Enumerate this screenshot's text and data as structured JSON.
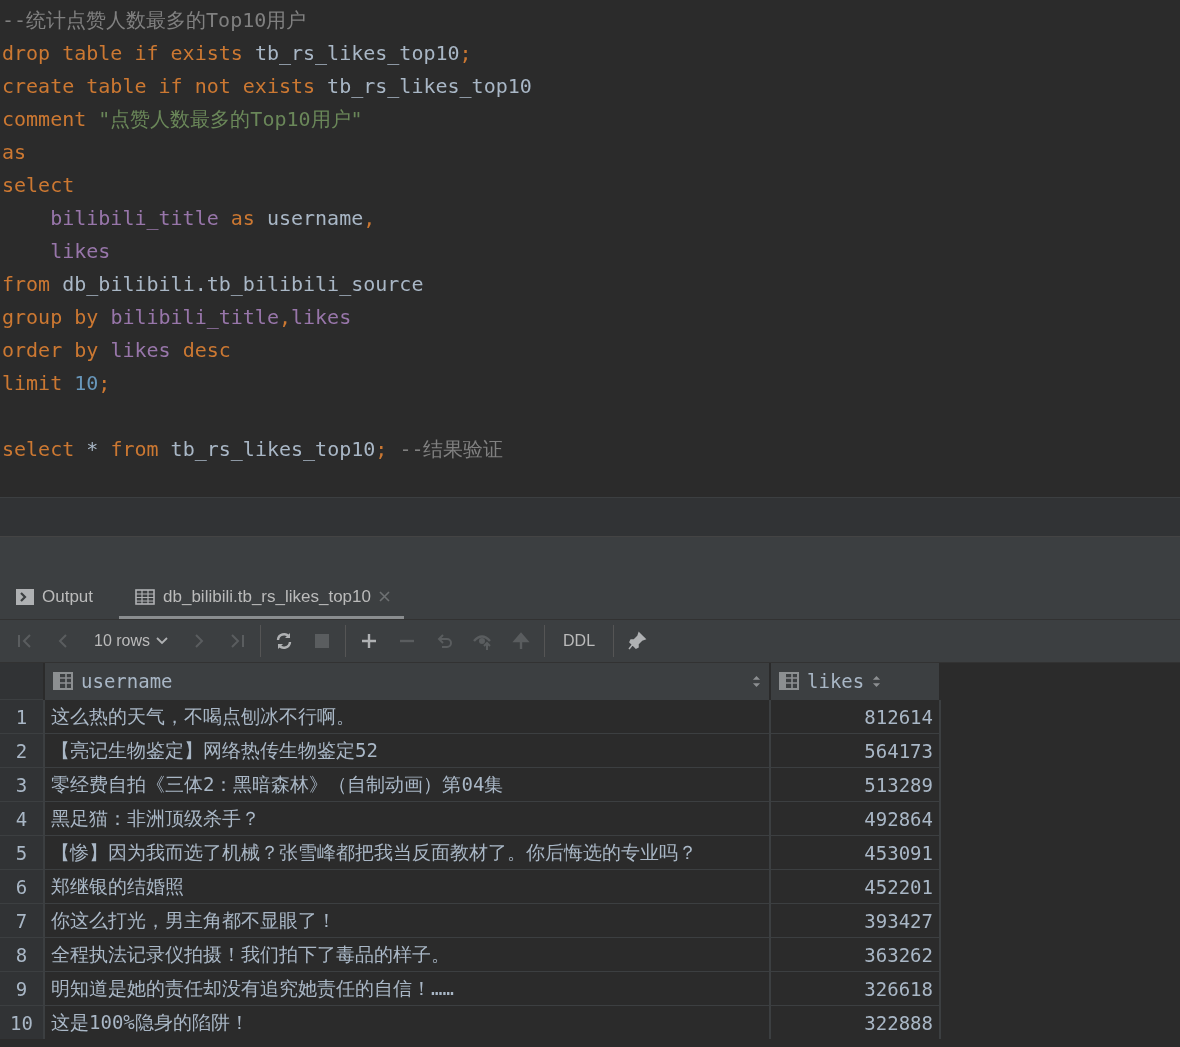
{
  "editor": {
    "lines": [
      {
        "kind": "code",
        "tokens": [
          {
            "text": "--统计点赞人数最多的Top10用户",
            "kind": "comment"
          }
        ]
      },
      {
        "kind": "code",
        "tokens": [
          {
            "text": "drop table if exists ",
            "kind": "keyword"
          },
          {
            "text": "tb_rs_likes_top10",
            "kind": "plain"
          },
          {
            "text": ";",
            "kind": "keyword"
          }
        ]
      },
      {
        "kind": "code",
        "tokens": [
          {
            "text": "create table if not exists ",
            "kind": "keyword"
          },
          {
            "text": "tb_rs_likes_top10",
            "kind": "plain"
          }
        ]
      },
      {
        "kind": "code",
        "tokens": [
          {
            "text": "comment ",
            "kind": "keyword"
          },
          {
            "text": "\"点赞人数最多的Top10用户\"",
            "kind": "string"
          }
        ]
      },
      {
        "kind": "code",
        "tokens": [
          {
            "text": "as",
            "kind": "keyword"
          }
        ]
      },
      {
        "kind": "code",
        "tokens": [
          {
            "text": "select",
            "kind": "keyword"
          }
        ]
      },
      {
        "kind": "code",
        "tokens": [
          {
            "text": "    bilibili_title ",
            "kind": "column"
          },
          {
            "text": "as ",
            "kind": "keyword"
          },
          {
            "text": "username",
            "kind": "plain"
          },
          {
            "text": ",",
            "kind": "keyword"
          }
        ]
      },
      {
        "kind": "code",
        "tokens": [
          {
            "text": "    likes",
            "kind": "column"
          }
        ]
      },
      {
        "kind": "code",
        "tokens": [
          {
            "text": "from ",
            "kind": "keyword"
          },
          {
            "text": "db_bilibili.tb_bilibili_source",
            "kind": "plain"
          }
        ]
      },
      {
        "kind": "code",
        "tokens": [
          {
            "text": "group by ",
            "kind": "keyword"
          },
          {
            "text": "bilibili_title",
            "kind": "column"
          },
          {
            "text": ",",
            "kind": "keyword"
          },
          {
            "text": "likes",
            "kind": "column"
          }
        ]
      },
      {
        "kind": "code",
        "tokens": [
          {
            "text": "order by ",
            "kind": "keyword"
          },
          {
            "text": "likes ",
            "kind": "column"
          },
          {
            "text": "desc",
            "kind": "keyword"
          }
        ]
      },
      {
        "kind": "code",
        "tokens": [
          {
            "text": "limit ",
            "kind": "keyword"
          },
          {
            "text": "10",
            "kind": "number"
          },
          {
            "text": ";",
            "kind": "keyword"
          }
        ]
      },
      {
        "kind": "blank"
      },
      {
        "kind": "code",
        "tokens": [
          {
            "text": "select ",
            "kind": "keyword"
          },
          {
            "text": "* ",
            "kind": "plain"
          },
          {
            "text": "from ",
            "kind": "keyword"
          },
          {
            "text": "tb_rs_likes_top10",
            "kind": "plain"
          },
          {
            "text": "; ",
            "kind": "keyword"
          },
          {
            "text": "--结果验证",
            "kind": "comment"
          }
        ]
      }
    ]
  },
  "results": {
    "tabs": [
      {
        "label": "Output",
        "kind": "console",
        "selected": false,
        "closable": false
      },
      {
        "label": "db_bilibili.tb_rs_likes_top10",
        "kind": "table",
        "selected": true,
        "closable": true
      }
    ],
    "toolbar": [
      {
        "kind": "first",
        "disabled": true
      },
      {
        "kind": "prev",
        "disabled": true
      },
      {
        "kind": "rows",
        "label": "10 rows",
        "disabled": false
      },
      {
        "kind": "next",
        "disabled": true
      },
      {
        "kind": "last",
        "disabled": true
      },
      {
        "kind": "sep"
      },
      {
        "kind": "refresh",
        "disabled": false
      },
      {
        "kind": "stop",
        "disabled": true
      },
      {
        "kind": "sep"
      },
      {
        "kind": "add",
        "disabled": false
      },
      {
        "kind": "remove",
        "disabled": true
      },
      {
        "kind": "revert",
        "disabled": true
      },
      {
        "kind": "preview",
        "disabled": true
      },
      {
        "kind": "submit",
        "disabled": true
      },
      {
        "kind": "sep"
      },
      {
        "kind": "ddl",
        "label": "DDL",
        "disabled": false
      },
      {
        "kind": "sep"
      },
      {
        "kind": "pin",
        "disabled": false
      }
    ],
    "columns": [
      "username",
      "likes"
    ],
    "rows": [
      {
        "num": "1",
        "cells": [
          "这么热的天气，不喝点刨冰不行啊。",
          "812614"
        ]
      },
      {
        "num": "2",
        "cells": [
          "【亮记生物鉴定】网络热传生物鉴定52",
          "564173"
        ]
      },
      {
        "num": "3",
        "cells": [
          "零经费自拍《三体2：黑暗森林》（自制动画）第04集",
          "513289"
        ]
      },
      {
        "num": "4",
        "cells": [
          "黑足猫：非洲顶级杀手？",
          "492864"
        ]
      },
      {
        "num": "5",
        "cells": [
          "【惨】因为我而选了机械？张雪峰都把我当反面教材了。你后悔选的专业吗？",
          "453091"
        ]
      },
      {
        "num": "6",
        "cells": [
          "郑继银的结婚照",
          "452201"
        ]
      },
      {
        "num": "7",
        "cells": [
          "你这么打光，男主角都不显眼了！",
          "393427"
        ]
      },
      {
        "num": "8",
        "cells": [
          "全程执法记录仪拍摄！我们拍下了毒品的样子。",
          "363262"
        ]
      },
      {
        "num": "9",
        "cells": [
          "明知道是她的责任却没有追究她责任的自信！……",
          "326618"
        ]
      },
      {
        "num": "10",
        "cells": [
          "这是100%隐身的陷阱！",
          "322888"
        ]
      }
    ]
  }
}
